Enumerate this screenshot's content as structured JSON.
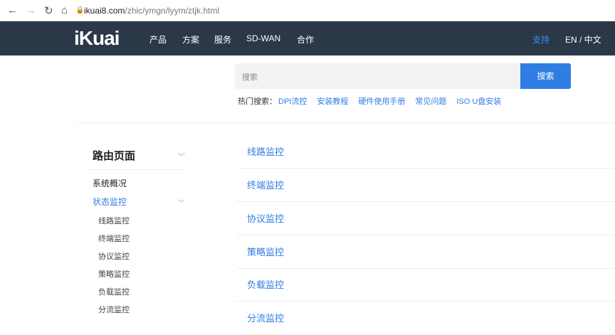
{
  "browser": {
    "url_domain": "ikuai8.com",
    "url_path": "/zhic/ymgn/lyym/ztjk.html"
  },
  "nav": {
    "logo": "iKuai",
    "items": [
      "产品",
      "方案",
      "服务",
      "SD-WAN",
      "合作"
    ],
    "support": "支持",
    "lang": "EN / 中文"
  },
  "search": {
    "placeholder": "搜索",
    "button": "搜索",
    "hot_label": "热门搜索：",
    "hot": [
      "DPI流控",
      "安装教程",
      "硬件使用手册",
      "常见问题",
      "ISO U盘安装"
    ]
  },
  "sidebar": {
    "title": "路由页面",
    "items": [
      "系统概况",
      "状态监控"
    ],
    "sub": [
      "线路监控",
      "终端监控",
      "协议监控",
      "策略监控",
      "负载监控",
      "分流监控"
    ]
  },
  "main": {
    "items": [
      "线路监控",
      "终端监控",
      "协议监控",
      "策略监控",
      "负载监控",
      "分流监控"
    ]
  }
}
